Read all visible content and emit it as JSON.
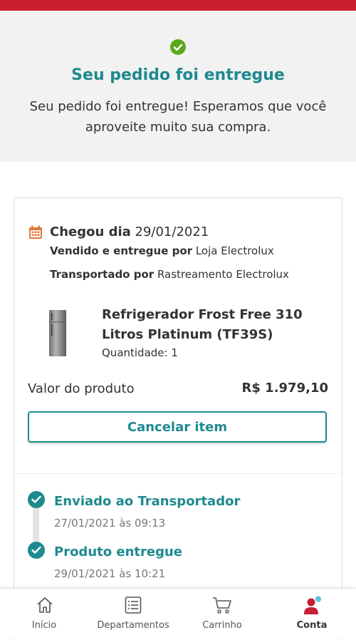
{
  "header": {
    "title": "Seu pedido foi entregue",
    "message": "Seu pedido foi entregue! Esperamos que você aproveite muito sua compra."
  },
  "order": {
    "arrived_label": "Chegou dia",
    "arrived_date": "29/01/2021",
    "seller_label": "Vendido e entregue por",
    "seller_value": "Loja Electrolux",
    "carrier_label": "Transportado por",
    "carrier_value": "Rastreamento Electrolux",
    "product_name": "Refrigerador Frost Free 310 Litros Platinum (TF39S)",
    "quantity": "Quantidade: 1",
    "value_label": "Valor do produto",
    "value_amount": "R$ 1.979,10",
    "cancel_label": "Cancelar item"
  },
  "timeline": [
    {
      "title": "Enviado ao Transportador",
      "date": "27/01/2021 às 09:13"
    },
    {
      "title": "Produto entregue",
      "date": "29/01/2021 às 10:21"
    }
  ],
  "nav": [
    {
      "label": "Início",
      "icon": "home-icon"
    },
    {
      "label": "Departamentos",
      "icon": "list-icon"
    },
    {
      "label": "Carrinho",
      "icon": "cart-icon"
    },
    {
      "label": "Conta",
      "icon": "user-icon",
      "active": true
    }
  ],
  "colors": {
    "brand_red": "#cc1f2d",
    "accent_teal": "#1e8a8f",
    "success_green": "#5aa91e",
    "calendar_orange": "#e07b39"
  }
}
